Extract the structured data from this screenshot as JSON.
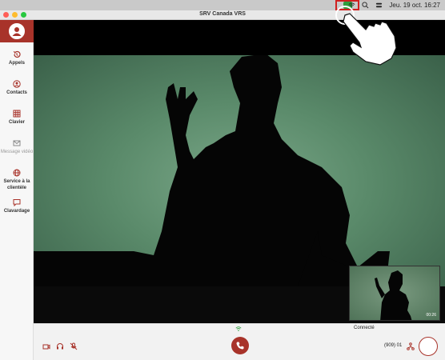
{
  "menubar": {
    "datetime": "Jeu. 19 oct. 16:27"
  },
  "window": {
    "title": "SRV Canada VRS"
  },
  "sidebar": {
    "items": [
      {
        "label": "Appels",
        "icon": "history-icon",
        "enabled": true
      },
      {
        "label": "Contacts",
        "icon": "contact-icon",
        "enabled": true
      },
      {
        "label": "Clavier",
        "icon": "keypad-icon",
        "enabled": true
      },
      {
        "label": "Message vidéo",
        "icon": "mail-icon",
        "enabled": false
      },
      {
        "label": "Service à la clientèle",
        "icon": "globe-icon",
        "enabled": true
      },
      {
        "label": "Clavardage",
        "icon": "chat-icon",
        "enabled": true
      }
    ]
  },
  "pip": {
    "timer": "00:26"
  },
  "status": {
    "connection": "Connecté"
  },
  "controls": {
    "phone_number": "(909) 01"
  },
  "colors": {
    "brand": "#a8332a",
    "highlight": "#d02020",
    "app_status": "#2e9e3c"
  }
}
